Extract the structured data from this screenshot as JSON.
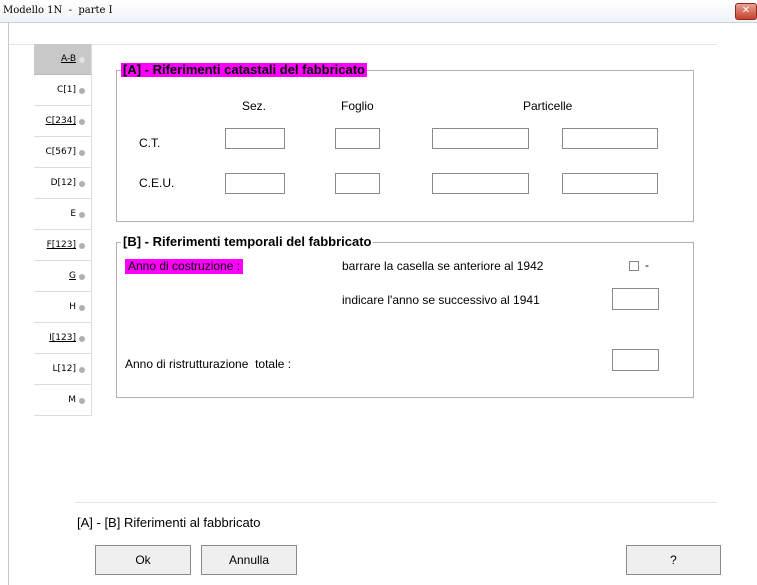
{
  "window": {
    "title": "Modello 1N  -  parte I",
    "close_glyph": "✕"
  },
  "tabs": [
    {
      "label": "A-B",
      "underline": true,
      "active": true
    },
    {
      "label": "C[1]",
      "underline": false,
      "active": false
    },
    {
      "label": "C[234]",
      "underline": true,
      "active": false
    },
    {
      "label": "C[567]",
      "underline": false,
      "active": false
    },
    {
      "label": "D[12]",
      "underline": false,
      "active": false
    },
    {
      "label": "E",
      "underline": false,
      "active": false
    },
    {
      "label": "F[123]",
      "underline": true,
      "active": false
    },
    {
      "label": "G",
      "underline": true,
      "active": false
    },
    {
      "label": "H",
      "underline": false,
      "active": false
    },
    {
      "label": "I[123]",
      "underline": true,
      "active": false
    },
    {
      "label": "L[12]",
      "underline": false,
      "active": false
    },
    {
      "label": "M",
      "underline": false,
      "active": false
    }
  ],
  "sectionA": {
    "legend": "[A] - Riferimenti catastali del fabbricato",
    "col_sez": "Sez.",
    "col_foglio": "Foglio",
    "col_particelle": "Particelle",
    "row_ct": "C.T.",
    "row_ceu": "C.E.U."
  },
  "sectionB": {
    "legend": "[B] - Riferimenti temporali del fabbricato",
    "anno_costruzione": "Anno di costruzione :",
    "barrare_text": "barrare la casella se anteriore al 1942",
    "checkbox_suffix": "-",
    "indicare_text": "indicare l'anno se successivo al 1941",
    "ristrutturazione_label": "Anno di ristrutturazione  totale :"
  },
  "footer": {
    "title": "[A] - [B] Riferimenti al fabbricato",
    "ok_label": "Ok",
    "annulla_label": "Annulla",
    "help_label": "?"
  },
  "colors": {
    "highlight": "#ff00ff",
    "active_tab": "#c8c8c8"
  }
}
